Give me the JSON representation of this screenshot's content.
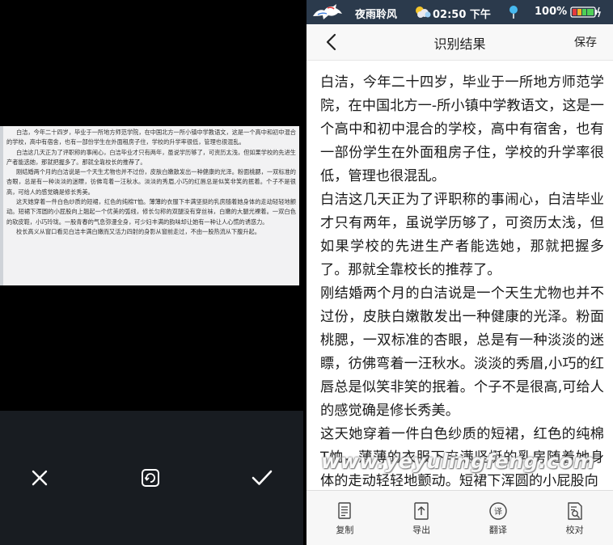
{
  "left": {
    "preview_paragraphs": [
      "白洁，今年二十四岁，毕业于一所地方师范学院，在中国北方一所小镇中学教语文，这是一个高中和初中混合的学校，高中有宿舍，也有一部份学生在外面租房子住，学校的升学率很低，管理也很混乱。",
      "白洁这几天正为了评职称的事闹心，白洁毕业才只有两年，虽说学历够了，可资历太浅，但如果学校的先进生产者能选她，那就把握多了。那就全靠校长的推荐了。",
      "刚结婚两个月的白洁说是一个天生尤物也并不过份，皮肤白嫩散发出一种健康的光泽。粉面桃腮，一双标准的杏眼，总是有一种淡淡的迷瞟，彷佛弯着一汪秋水。淡淡的秀眉,小巧的红唇总是似笑非笑的抿着。个子不是很高，可给人的感觉确是修长秀美。",
      "这天她穿着一件白色纱质的短裙，红色的纯棉T恤。薄薄的衣服下丰满坚挺的乳房随着她身体的走动轻轻地颤动。短裙下浑圆的小屁股向上翘起一个优美的弧线，修长匀称的双腿没有穿丝袜，白嫩的大腿光裸着。一双白色的软皮鞋，小巧玲珑。一股青春的气息弥漫全身，可少妇丰满的韵味却让她有一种让人心慌的诱惑力。",
      "校长高义从窗口看见白洁丰满白嫩而又活力四射的身影从窗前走过，不由一股热流从下腹升起。"
    ],
    "actions": {
      "cancel_icon": "close-icon",
      "rotate_icon": "rotate-icon",
      "confirm_icon": "check-icon"
    }
  },
  "status_bar": {
    "app_name": "夜雨聆风",
    "time": "02:50 下午",
    "battery": "100%"
  },
  "header": {
    "title": "识别结果",
    "save_label": "保存"
  },
  "content": {
    "paragraphs": [
      "白洁，今年二十四岁，毕业于一所地方师范学院，在中国北方一-所小镇中学教语文，这是一个高中和初中混合的学校，高中有宿舍，也有一部份学生在外面租房子住，学校的升学率很低，管理也很混乱。",
      "白洁这几天正为了评职称的事闹心，白洁毕业才只有两年，虽说学历够了，可资历太浅，但如果学校的先进生产者能选她，那就把握多了。那就全靠校长的推荐了。",
      "刚结婚两个月的白洁说是一个天生尤物也并不过份，皮肤白嫩散发出一种健康的光泽。粉面桃腮，一双标准的杏眼，总是有一种淡淡的迷瞟，彷佛弯着一汪秋水。淡淡的秀眉,小巧的红唇总是似笑非笑的抿着。个子不是很高,可给人的感觉确是修长秀美。",
      "这天她穿着一件白色纱质的短裙，红色的纯棉T恤，薄薄的衣服下丰满坚挺的乳房随着她身体的走动轻轻地颤动。短裙下浑圆的小屁股向"
    ],
    "watermark": "www.yeyulingfeng.com"
  },
  "tabs": [
    {
      "label": "复制",
      "icon": "copy-icon"
    },
    {
      "label": "导出",
      "icon": "export-icon"
    },
    {
      "label": "翻译",
      "icon": "translate-icon"
    },
    {
      "label": "校对",
      "icon": "proofread-icon"
    }
  ],
  "colors": {
    "status_bar": "#2b3a4c",
    "left_background": "#000000",
    "left_toolbar": "#181c21"
  }
}
